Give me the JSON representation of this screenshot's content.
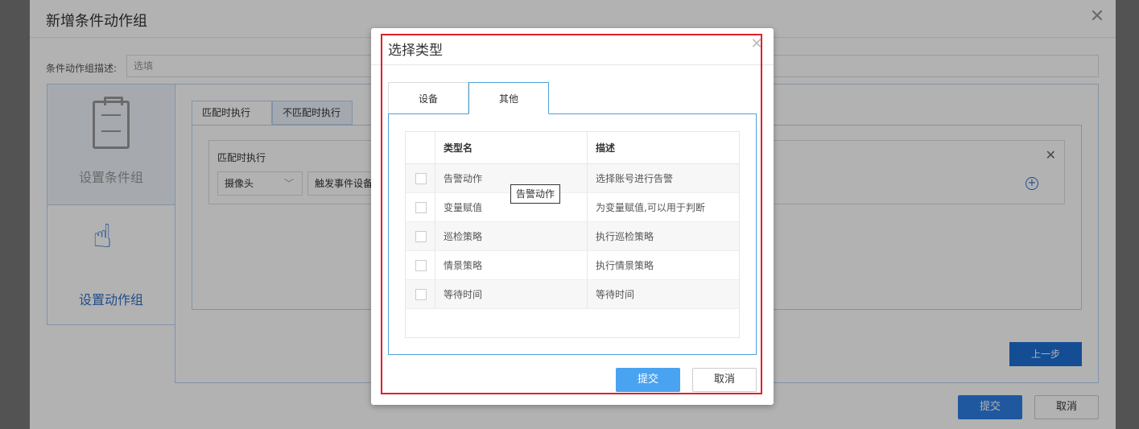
{
  "outer": {
    "title": "新增条件动作组",
    "desc_label": "条件动作组描述:",
    "desc_placeholder": "选填",
    "side_condition_label": "设置条件组",
    "side_action_label": "设置动作组",
    "tab_match": "匹配时执行",
    "tab_nomatch": "不匹配时执行",
    "match_title": "匹配时执行",
    "select_device_type": "摄像头",
    "select_event_device": "触发事件设备",
    "prev_button": "上一步",
    "submit_button": "提交",
    "cancel_button": "取消"
  },
  "modal": {
    "title": "选择类型",
    "tabs": [
      {
        "label": "设备",
        "active": false
      },
      {
        "label": "其他",
        "active": true
      }
    ],
    "table": {
      "headers": [
        "类型名",
        "描述"
      ],
      "rows": [
        {
          "name": "告警动作",
          "desc": "选择账号进行告警"
        },
        {
          "name": "变量赋值",
          "desc": "为变量赋值,可以用于判断"
        },
        {
          "name": "巡检策略",
          "desc": "执行巡检策略"
        },
        {
          "name": "情景策略",
          "desc": "执行情景策略"
        },
        {
          "name": "等待时间",
          "desc": "等待时间"
        }
      ]
    },
    "tooltip": "告警动作",
    "submit_button": "提交",
    "cancel_button": "取消"
  },
  "colors": {
    "primary": "#4aa3f0",
    "highlight_frame": "#e0202a",
    "tab_border": "#4aa3d6"
  }
}
